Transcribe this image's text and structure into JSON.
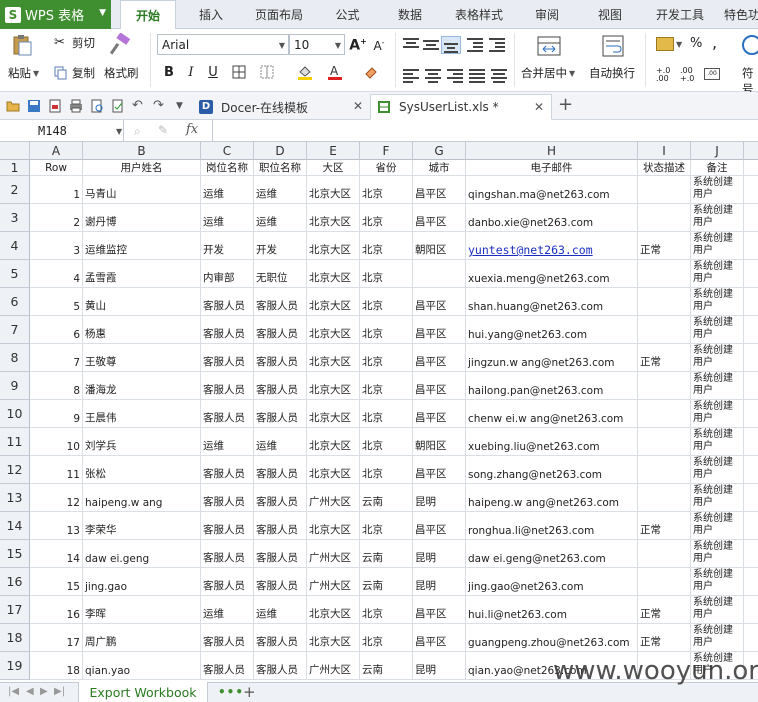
{
  "app": {
    "name": "WPS 表格",
    "logo_letter": "S"
  },
  "ribbon_tabs": [
    "开始",
    "插入",
    "页面布局",
    "公式",
    "数据",
    "表格样式",
    "审阅",
    "视图",
    "开发工具",
    "特色功"
  ],
  "toolbar": {
    "paste": "粘贴",
    "cut": "剪切",
    "copy": "复制",
    "format_painter": "格式刷",
    "font_name": "Arial",
    "font_size": "10",
    "bold": "B",
    "italic": "I",
    "underline": "U",
    "merge_center": "合并居中",
    "wrap_text": "自动换行",
    "percent": "%",
    "comma": ",",
    "symbol": "符号",
    "inc_decimal": "+.0 .00",
    "dec_decimal": ".00 +.0"
  },
  "doc_tabs": [
    {
      "label": "Docer-在线模板",
      "active": false
    },
    {
      "label": "SysUserList.xls *",
      "active": true
    }
  ],
  "formula_bar": {
    "cell_ref": "M148",
    "fx": "fx",
    "content": ""
  },
  "columns": [
    "A",
    "B",
    "C",
    "D",
    "E",
    "F",
    "G",
    "H",
    "I",
    "J"
  ],
  "header_row": {
    "row_num": "1",
    "cells": [
      "Row",
      "用户姓名",
      "岗位名称",
      "职位名称",
      "大区",
      "省份",
      "城市",
      "电子邮件",
      "状态描述",
      "备注"
    ]
  },
  "rows": [
    {
      "rn": "2",
      "cells": [
        "1",
        "马青山",
        "运维",
        "运维",
        "北京大区",
        "北京",
        "昌平区",
        "qingshan.ma@net263.com",
        "",
        "系统创建用户"
      ]
    },
    {
      "rn": "3",
      "cells": [
        "2",
        "谢丹博",
        "运维",
        "运维",
        "北京大区",
        "北京",
        "昌平区",
        "danbo.xie@net263.com",
        "",
        "系统创建用户"
      ]
    },
    {
      "rn": "4",
      "cells": [
        "3",
        "运维监控",
        "开发",
        "开发",
        "北京大区",
        "北京",
        "朝阳区",
        "yuntest@net263.com",
        "正常",
        "系统创建用户"
      ]
    },
    {
      "rn": "5",
      "cells": [
        "4",
        "孟雪霞",
        "内审部",
        "无职位",
        "北京大区",
        "北京",
        "",
        "xuexia.meng@net263.com",
        "",
        "系统创建用户"
      ]
    },
    {
      "rn": "6",
      "cells": [
        "5",
        "黄山",
        "客服人员",
        "客服人员",
        "北京大区",
        "北京",
        "昌平区",
        "shan.huang@net263.com",
        "",
        "系统创建用户"
      ]
    },
    {
      "rn": "7",
      "cells": [
        "6",
        "杨惠",
        "客服人员",
        "客服人员",
        "北京大区",
        "北京",
        "昌平区",
        "hui.yang@net263.com",
        "",
        "系统创建用户"
      ]
    },
    {
      "rn": "8",
      "cells": [
        "7",
        "王敬尊",
        "客服人员",
        "客服人员",
        "北京大区",
        "北京",
        "昌平区",
        "jingzun.w ang@net263.com",
        "正常",
        "系统创建用户"
      ]
    },
    {
      "rn": "9",
      "cells": [
        "8",
        "潘海龙",
        "客服人员",
        "客服人员",
        "北京大区",
        "北京",
        "昌平区",
        "hailong.pan@net263.com",
        "",
        "系统创建用户"
      ]
    },
    {
      "rn": "10",
      "cells": [
        "9",
        "王晨伟",
        "客服人员",
        "客服人员",
        "北京大区",
        "北京",
        "昌平区",
        "chenw ei.w ang@net263.com",
        "",
        "系统创建用户"
      ]
    },
    {
      "rn": "11",
      "cells": [
        "10",
        "刘学兵",
        "运维",
        "运维",
        "北京大区",
        "北京",
        "朝阳区",
        "xuebing.liu@net263.com",
        "",
        "系统创建用户"
      ]
    },
    {
      "rn": "12",
      "cells": [
        "11",
        "张松",
        "客服人员",
        "客服人员",
        "北京大区",
        "北京",
        "昌平区",
        "song.zhang@net263.com",
        "",
        "系统创建用户"
      ]
    },
    {
      "rn": "13",
      "cells": [
        "12",
        "haipeng.w ang",
        "客服人员",
        "客服人员",
        "广州大区",
        "云南",
        "昆明",
        "haipeng.w ang@net263.com",
        "",
        "系统创建用户"
      ]
    },
    {
      "rn": "14",
      "cells": [
        "13",
        "李荣华",
        "客服人员",
        "客服人员",
        "北京大区",
        "北京",
        "昌平区",
        "ronghua.li@net263.com",
        "正常",
        "系统创建用户"
      ]
    },
    {
      "rn": "15",
      "cells": [
        "14",
        "daw ei.geng",
        "客服人员",
        "客服人员",
        "广州大区",
        "云南",
        "昆明",
        "daw ei.geng@net263.com",
        "",
        "系统创建用户"
      ]
    },
    {
      "rn": "16",
      "cells": [
        "15",
        "jing.gao",
        "客服人员",
        "客服人员",
        "广州大区",
        "云南",
        "昆明",
        "jing.gao@net263.com",
        "",
        "系统创建用户"
      ]
    },
    {
      "rn": "17",
      "cells": [
        "16",
        "李晖",
        "运维",
        "运维",
        "北京大区",
        "北京",
        "昌平区",
        "hui.li@net263.com",
        "正常",
        "系统创建用户"
      ]
    },
    {
      "rn": "18",
      "cells": [
        "17",
        "周广鹏",
        "客服人员",
        "客服人员",
        "北京大区",
        "北京",
        "昌平区",
        "guangpeng.zhou@net263.com",
        "正常",
        "系统创建用户"
      ]
    },
    {
      "rn": "19",
      "cells": [
        "18",
        "qian.yao",
        "客服人员",
        "客服人员",
        "广州大区",
        "云南",
        "昆明",
        "qian.yao@net263.com",
        "",
        "系统创建用户"
      ]
    }
  ],
  "sheet_tabs": {
    "active": "Export Workbook",
    "dots": "•••",
    "add": "+"
  },
  "watermark": "www.wooyun.org",
  "colors": {
    "brand_green": "#3f8e2f",
    "tab_green": "#2b7a22",
    "link_blue": "#1a2fbf"
  }
}
